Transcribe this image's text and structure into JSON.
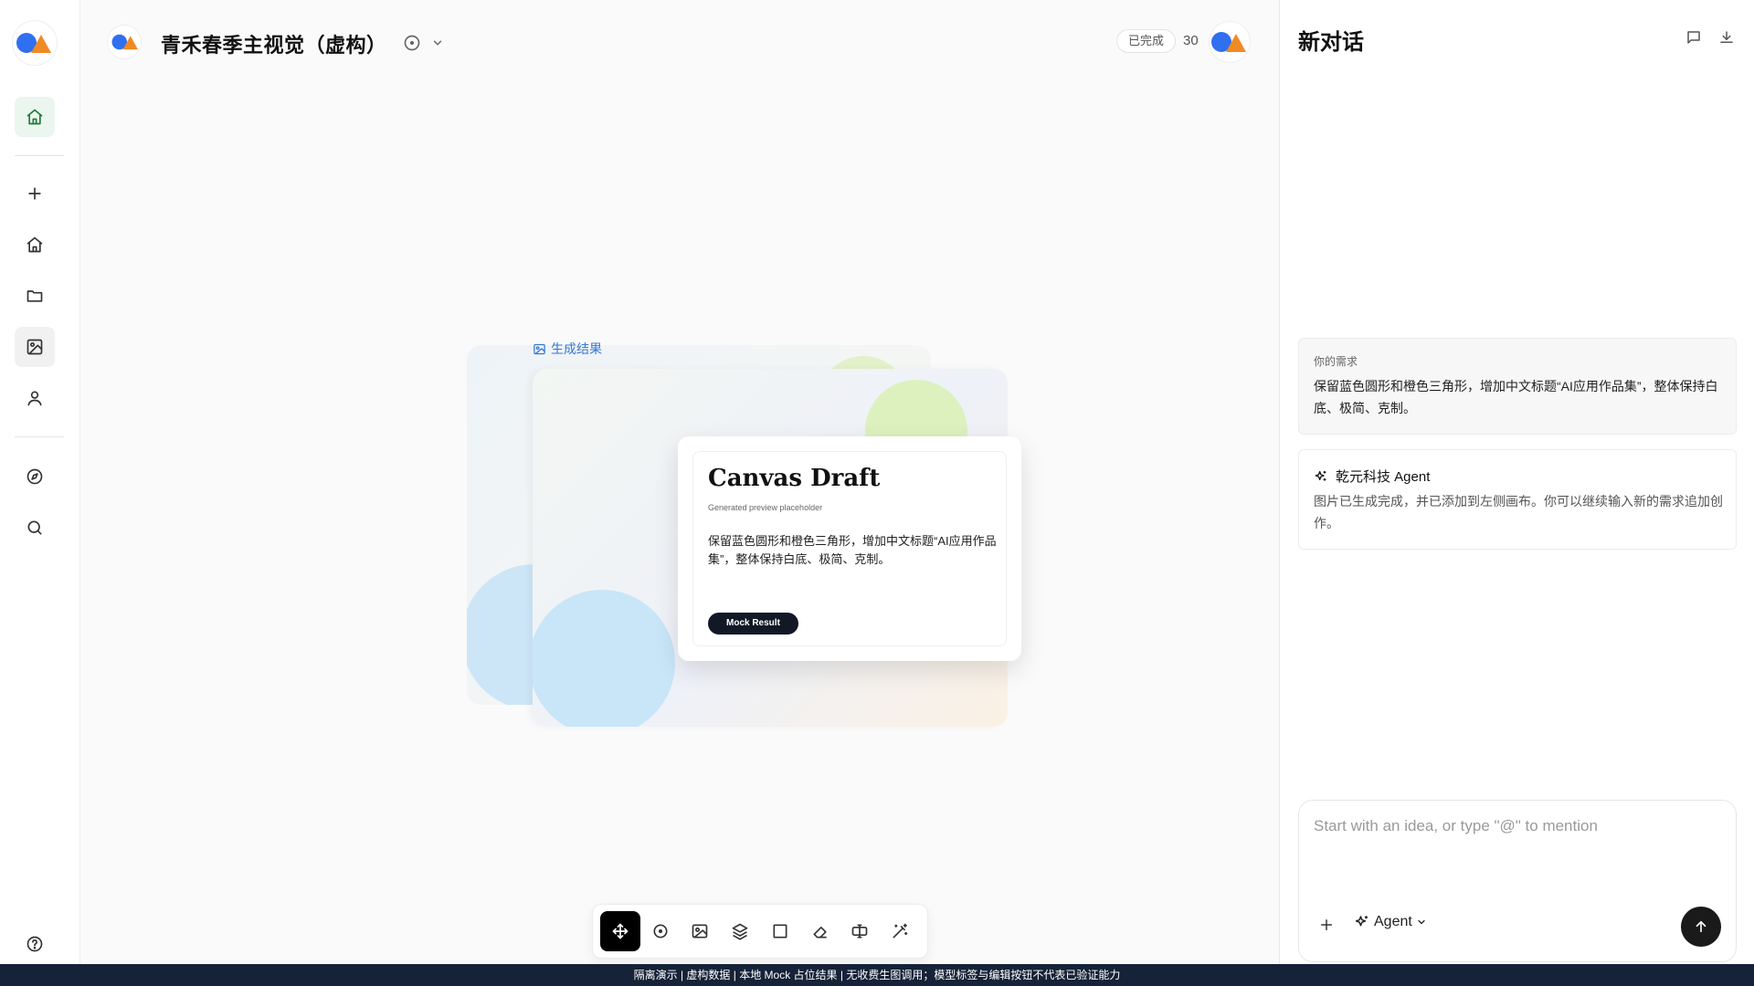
{
  "app": {
    "project_title": "青禾春季主视觉（虚构）",
    "status": "已完成",
    "count": "30"
  },
  "rail": {
    "items": [
      {
        "icon": "home-icon",
        "active": true
      },
      {
        "icon": "plus-icon"
      },
      {
        "icon": "home-icon"
      },
      {
        "icon": "folder-icon"
      },
      {
        "icon": "image-edit-icon",
        "active": true
      },
      {
        "icon": "user-icon"
      },
      {
        "icon": "compass-icon"
      },
      {
        "icon": "search-icon"
      },
      {
        "icon": "help-icon"
      }
    ]
  },
  "canvas": {
    "result_label": "生成结果",
    "card": {
      "title": "Canvas Draft",
      "subtitle": "Generated preview placeholder",
      "body": "保留蓝色圆形和橙色三角形，增加中文标题“AI应用作品集”，整体保持白底、极简、克制。",
      "button": "Mock Result"
    },
    "toolbar": [
      "move-icon",
      "circle-dot-icon",
      "image-icon",
      "layers-icon",
      "square-icon",
      "eraser-icon",
      "text-cursor-icon",
      "magic-wand-icon"
    ]
  },
  "chat": {
    "title": "新对话",
    "user_message": {
      "label": "你的需求",
      "text": "保留蓝色圆形和橙色三角形，增加中文标题“AI应用作品集”，整体保持白底、极简、克制。"
    },
    "agent_message": {
      "name": "乾元科技 Agent",
      "text": "图片已生成完成，并已添加到左侧画布。你可以继续输入新的需求追加创作。"
    },
    "composer": {
      "placeholder": "Start with an idea, or type \"@\" to mention",
      "value": "",
      "mode": "Agent"
    }
  },
  "footer": {
    "text": "隔离演示 | 虚构数据 | 本地 Mock 占位结果 | 无收费生图调用；模型标签与编辑按钮不代表已验证能力"
  },
  "colors": {
    "brand_blue": "#2f6ff0",
    "brand_orange": "#f08a24",
    "footer_bg": "#152238",
    "link_blue": "#3478d4"
  }
}
